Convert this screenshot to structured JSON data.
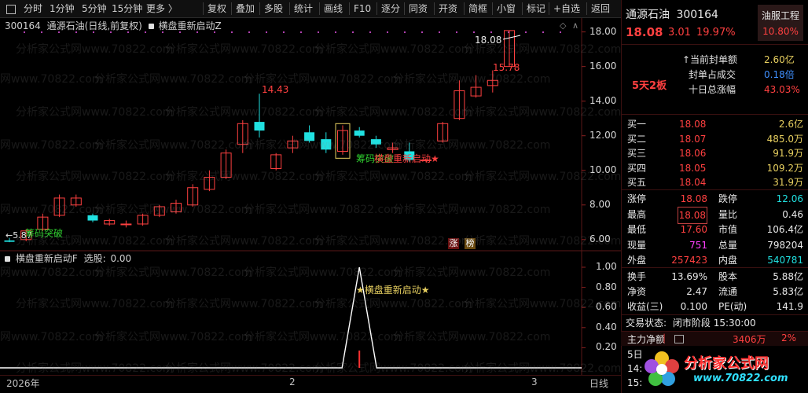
{
  "toolbar": {
    "left_tabs": [
      "分时",
      "1分钟",
      "5分钟",
      "15分钟",
      "更多 〉"
    ],
    "buttons": [
      "复权",
      "叠加",
      "多股",
      "统计",
      "画线",
      "F10",
      "逐分",
      "同资",
      "开资",
      "简框",
      "小窗",
      "标记",
      "+自选",
      "返回"
    ]
  },
  "main_chart": {
    "title_code": "300164",
    "title_info": "通源石油(日线,前复权)",
    "indicator_name": "横盘重新启动Z",
    "price_labels": [
      "18.00",
      "16.00",
      "14.00",
      "12.00",
      "10.00",
      "8.00",
      "6.00"
    ],
    "high_annotation": "14.43",
    "peak_annotation": "15.78",
    "current_annotation": "18.08",
    "low_annotation": "5.87",
    "signal_breakout_1": "筹码突破",
    "signal_breakout_2": "筹码突破",
    "signal_restart": "横盘重新启动★",
    "badge_zhang": "涨",
    "badge_bang": "榜"
  },
  "sub_chart": {
    "title": "横盘重新启动F",
    "select_label": "选股:",
    "select_value": "0.00",
    "y_labels": [
      "1.00",
      "0.80",
      "0.60",
      "0.40",
      "0.20"
    ],
    "signal_label": "★横盘重新启动★"
  },
  "date_axis": {
    "labels": [
      "2026年",
      "2",
      "3"
    ],
    "period": "日线"
  },
  "stock_header": {
    "name": "通源石油",
    "code": "300164",
    "sector": "油服工程",
    "price": "18.08",
    "change": "3.01",
    "change_pct": "19.97%",
    "sector_pct": "10.80%"
  },
  "limit_info": {
    "streak": "5天2板",
    "rows": [
      {
        "label": "↑当前封单额",
        "value": "2.60亿"
      },
      {
        "label": "封单占成交",
        "value": "0.18倍"
      },
      {
        "label": "十日总涨幅",
        "value": "43.03%"
      }
    ]
  },
  "order_book": [
    {
      "label": "买一",
      "price": "18.08",
      "vol": "2.6亿"
    },
    {
      "label": "买二",
      "price": "18.07",
      "vol": "485.0万"
    },
    {
      "label": "买三",
      "price": "18.06",
      "vol": "91.9万"
    },
    {
      "label": "买四",
      "price": "18.05",
      "vol": "109.2万"
    },
    {
      "label": "买五",
      "price": "18.04",
      "vol": "31.9万"
    }
  ],
  "stats_a": [
    {
      "l1": "涨停",
      "v1": "18.08",
      "l2": "跌停",
      "v2": "12.06"
    },
    {
      "l1": "最高",
      "v1": "18.08",
      "l2": "量比",
      "v2": "0.46"
    },
    {
      "l1": "最低",
      "v1": "17.60",
      "l2": "市值",
      "v2": "106.4亿"
    },
    {
      "l1": "现量",
      "v1": "751",
      "l2": "总量",
      "v2": "798204"
    },
    {
      "l1": "外盘",
      "v1": "257423",
      "l2": "内盘",
      "v2": "540781"
    }
  ],
  "stats_b": [
    {
      "l1": "换手",
      "v1": "13.69%",
      "l2": "股本",
      "v2": "5.88亿"
    },
    {
      "l1": "净资",
      "v1": "2.47",
      "l2": "流通",
      "v2": "5.83亿"
    },
    {
      "l1": "收益(三)",
      "v1": "0.100",
      "l2": "PE(动)",
      "v2": "141.9"
    }
  ],
  "trade_status": {
    "label": "交易状态:",
    "value": "闭市阶段 15:30:00"
  },
  "main_flow": {
    "label": "主力净额",
    "amount": "3406万",
    "pct": "2%"
  },
  "bottom_rows": [
    "5日",
    "14:",
    "15:"
  ],
  "watermark": {
    "brand": "分析家公式网",
    "url": "www.70822.com",
    "repeat_text": "分析家公式网www.70822.com"
  },
  "colors": {
    "up": "#ff4040",
    "down": "#20e0e0",
    "signal_green": "#30d030",
    "accent_yellow": "#e8d060",
    "bg": "#000000"
  },
  "chart_data": {
    "type": "candlestick",
    "ylim": [
      5.4,
      18.8
    ],
    "candles": [
      {
        "o": 5.95,
        "c": 5.87,
        "h": 6.1,
        "l": 5.85
      },
      {
        "o": 6.0,
        "c": 6.5,
        "h": 6.6,
        "l": 5.9
      },
      {
        "o": 6.6,
        "c": 7.3,
        "h": 7.5,
        "l": 6.5
      },
      {
        "o": 7.4,
        "c": 8.4,
        "h": 8.6,
        "l": 7.3
      },
      {
        "o": 8.0,
        "c": 8.4,
        "h": 8.6,
        "l": 7.9
      },
      {
        "o": 7.4,
        "c": 7.1,
        "h": 7.5,
        "l": 7.0
      },
      {
        "o": 6.9,
        "c": 7.1,
        "h": 7.2,
        "l": 6.8
      },
      {
        "o": 6.9,
        "c": 6.9,
        "h": 7.1,
        "l": 6.7
      },
      {
        "o": 6.9,
        "c": 7.4,
        "h": 7.5,
        "l": 6.8
      },
      {
        "o": 7.4,
        "c": 7.9,
        "h": 8.0,
        "l": 7.3
      },
      {
        "o": 7.6,
        "c": 8.1,
        "h": 8.3,
        "l": 7.5
      },
      {
        "o": 8.0,
        "c": 9.0,
        "h": 9.2,
        "l": 7.9
      },
      {
        "o": 8.9,
        "c": 9.6,
        "h": 10.0,
        "l": 8.8
      },
      {
        "o": 9.6,
        "c": 11.0,
        "h": 11.2,
        "l": 9.5
      },
      {
        "o": 11.5,
        "c": 12.7,
        "h": 12.9,
        "l": 11.0
      },
      {
        "o": 12.8,
        "c": 12.3,
        "h": 14.43,
        "l": 11.9
      },
      {
        "o": 10.1,
        "c": 10.9,
        "h": 11.0,
        "l": 10.0
      },
      {
        "o": 11.3,
        "c": 11.7,
        "h": 12.0,
        "l": 11.0
      },
      {
        "o": 12.2,
        "c": 11.7,
        "h": 12.6,
        "l": 11.6
      },
      {
        "o": 11.8,
        "c": 11.2,
        "h": 12.2,
        "l": 11.0
      },
      {
        "o": 11.1,
        "c": 12.3,
        "h": 12.6,
        "l": 10.9
      },
      {
        "o": 12.3,
        "c": 12.0,
        "h": 12.5,
        "l": 11.9
      },
      {
        "o": 11.8,
        "c": 11.5,
        "h": 12.0,
        "l": 11.3
      },
      {
        "o": 11.2,
        "c": 11.3,
        "h": 11.6,
        "l": 11.0
      },
      {
        "o": 11.1,
        "c": 10.6,
        "h": 11.6,
        "l": 10.5
      },
      {
        "o": 10.6,
        "c": 10.6,
        "h": 10.7,
        "l": 10.5
      },
      {
        "o": 11.7,
        "c": 12.7,
        "h": 12.8,
        "l": 11.6
      },
      {
        "o": 13.0,
        "c": 14.6,
        "h": 15.2,
        "l": 12.9
      },
      {
        "o": 14.3,
        "c": 14.8,
        "h": 15.5,
        "l": 14.2
      },
      {
        "o": 14.9,
        "c": 15.2,
        "h": 15.78,
        "l": 14.5
      },
      {
        "o": 16.0,
        "c": 18.08,
        "h": 18.08,
        "l": 16.0
      }
    ],
    "indicator": {
      "ylim": [
        0,
        1.0
      ],
      "spike_index": 21,
      "spike_value": 1.0
    }
  }
}
